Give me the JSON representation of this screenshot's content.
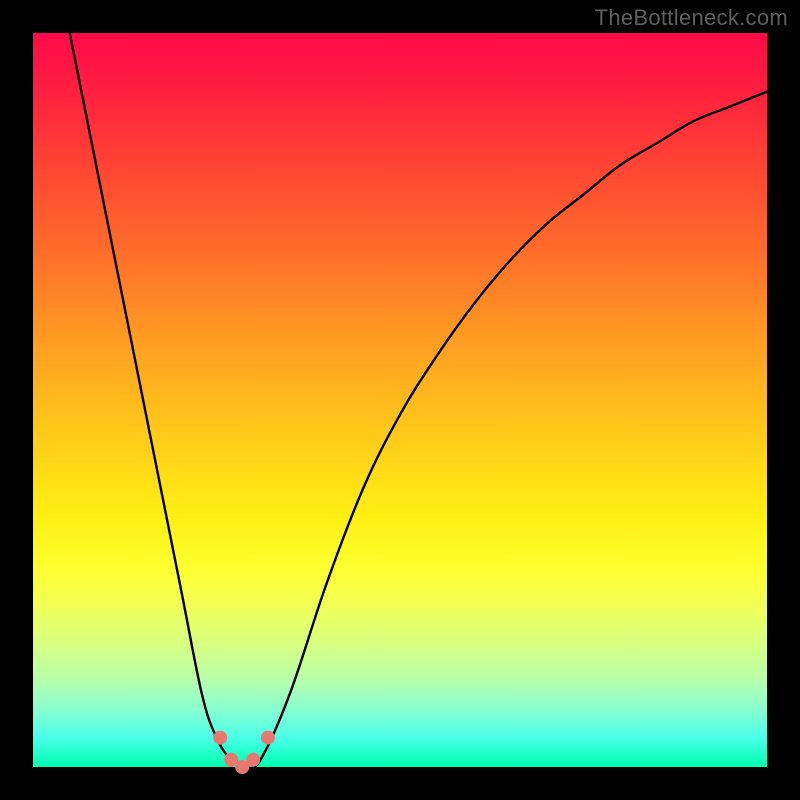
{
  "watermark": "TheBottleneck.com",
  "chart_data": {
    "type": "line",
    "title": "",
    "xlabel": "",
    "ylabel": "",
    "xlim": [
      0,
      100
    ],
    "ylim": [
      0,
      100
    ],
    "series": [
      {
        "name": "curve",
        "x": [
          5,
          10,
          15,
          20,
          23,
          25,
          27,
          29,
          31,
          35,
          40,
          45,
          50,
          55,
          60,
          65,
          70,
          75,
          80,
          85,
          90,
          95,
          100
        ],
        "values": [
          100,
          75,
          50,
          25,
          10,
          4,
          1,
          0,
          1,
          10,
          25,
          38,
          48,
          56,
          63,
          69,
          74,
          78,
          82,
          85,
          88,
          90,
          92
        ]
      }
    ],
    "markers": {
      "name": "highlight-dots",
      "color": "#e9776f",
      "points": [
        {
          "x": 25.5,
          "y": 4
        },
        {
          "x": 27.0,
          "y": 1
        },
        {
          "x": 28.5,
          "y": 0
        },
        {
          "x": 30.0,
          "y": 1
        },
        {
          "x": 32.0,
          "y": 4
        }
      ]
    }
  }
}
